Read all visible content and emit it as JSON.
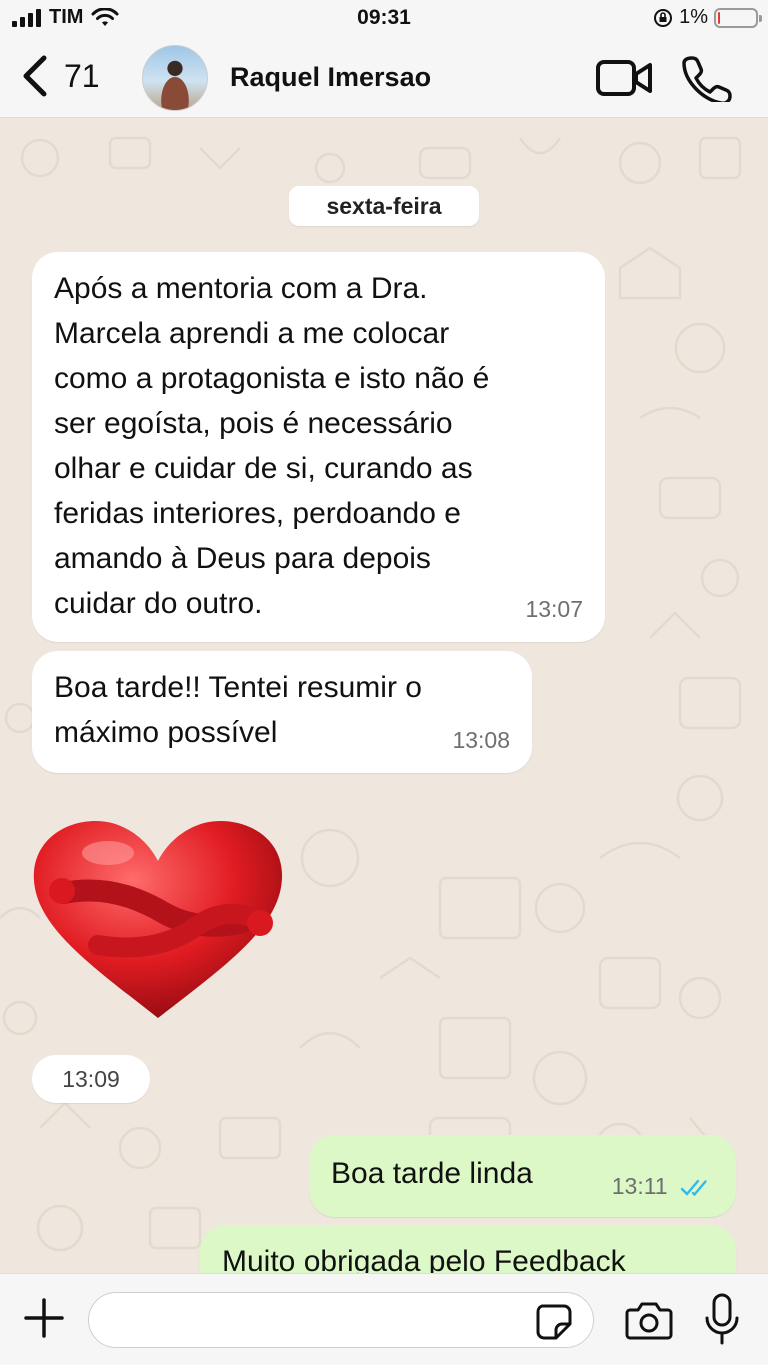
{
  "status_bar": {
    "carrier": "TIM",
    "time": "09:31",
    "battery_percent": "1%",
    "battery_level": 0.01,
    "icons": [
      "signal-icon",
      "wifi-icon",
      "rotation-lock-icon",
      "battery-icon"
    ]
  },
  "header": {
    "back_count": "71",
    "contact_name": "Raquel Imersao",
    "icons": [
      "back-chevron-icon",
      "video-call-icon",
      "phone-call-icon"
    ]
  },
  "chat": {
    "day_label": "sexta-feira",
    "messages": [
      {
        "direction": "incoming",
        "text": "Após a mentoria com a Dra.\nMarcela aprendi a me colocar\ncomo a protagonista e isto não é\nser egoísta,  pois  é necessário\nolhar e cuidar de si,  curando as\nferidas interiores, perdoando e\namando à Deus para depois\ncuidar do outro.",
        "time": "13:07"
      },
      {
        "direction": "incoming",
        "text": "Boa tarde!! Tentei resumir o\nmáximo possível",
        "time": "13:08"
      },
      {
        "direction": "incoming",
        "type": "sticker",
        "sticker": "hugging-heart-sticker",
        "time": "13:09"
      },
      {
        "direction": "outgoing",
        "text": "Boa tarde linda",
        "time": "13:11",
        "status": "read"
      },
      {
        "direction": "outgoing",
        "text": "Muito obrigada pelo Feedback",
        "time": ""
      }
    ]
  },
  "input_bar": {
    "placeholder": "",
    "icons": [
      "plus-icon",
      "sticker-icon",
      "camera-icon",
      "microphone-icon"
    ]
  },
  "colors": {
    "chat_background": "#efe7de",
    "incoming_bubble": "#ffffff",
    "outgoing_bubble": "#dcf8c6",
    "read_ticks": "#34b7f1",
    "battery_low": "#e53935"
  }
}
